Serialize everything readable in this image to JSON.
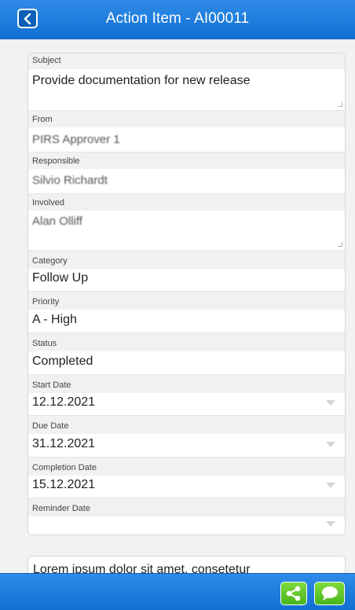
{
  "header": {
    "title": "Action Item - AI00011"
  },
  "fields": {
    "subject": {
      "label": "Subject",
      "value": "Provide documentation for new release"
    },
    "from": {
      "label": "From",
      "value": "PIRS Approver 1"
    },
    "responsible": {
      "label": "Responsible",
      "value": "Silvio Richardt"
    },
    "involved": {
      "label": "Involved",
      "value": "Alan Olliff"
    },
    "category": {
      "label": "Category",
      "value": "Follow Up"
    },
    "priority": {
      "label": "Priority",
      "value": "A - High"
    },
    "status": {
      "label": "Status",
      "value": "Completed"
    },
    "start_date": {
      "label": "Start Date",
      "value": "12.12.2021"
    },
    "due_date": {
      "label": "Due Date",
      "value": "31.12.2021"
    },
    "completion_date": {
      "label": "Completion Date",
      "value": "15.12.2021"
    },
    "reminder_date": {
      "label": "Reminder Date",
      "value": ""
    }
  },
  "notes": {
    "text": "Lorem ipsum dolor sit amet, consetetur"
  },
  "icons": {
    "back": "chevron-left-icon",
    "share": "share-icon",
    "comment": "comment-icon"
  },
  "colors": {
    "bar": "#1a7ddf",
    "action_green": "#5cc628"
  }
}
